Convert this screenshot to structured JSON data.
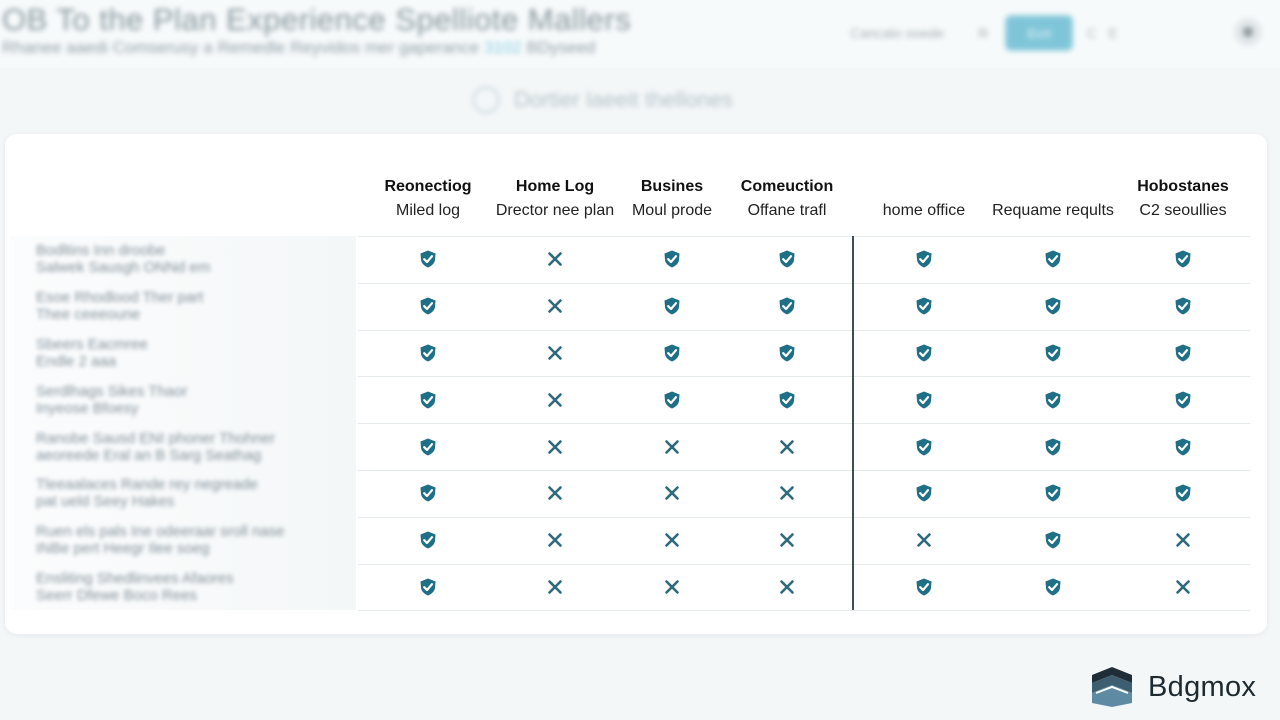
{
  "header": {
    "title": "OB To the Plan Experience Spelliote Mallers",
    "subtitle": "Rhanee aaedi Comserusy a Remedle Reyvidos mer gaperance",
    "subtitle_highlight": "3102",
    "subtitle_tail": "BDyseed",
    "actions": {
      "tab_text": "Cancalo ooede",
      "plain_button": "R",
      "primary_button": "Ecrt",
      "more": "C E"
    }
  },
  "section_heading": "Dortier laeeit thellones",
  "table": {
    "columns": [
      {
        "title": "Reonectiog",
        "subtitle": "Miled log"
      },
      {
        "title": "Home Log",
        "subtitle": "Drector nee plan"
      },
      {
        "title": "Busines",
        "subtitle": "Moul prode"
      },
      {
        "title": "Comeuction",
        "subtitle": "Offane trafl"
      },
      {
        "title": "",
        "subtitle": "home office"
      },
      {
        "title": "",
        "subtitle": "Requame reqults"
      },
      {
        "title": "Hobostanes",
        "subtitle": "C2 seoullies"
      }
    ],
    "rows": [
      {
        "label_1": "Bodltins Inn droobe",
        "label_2": "Salwek Sausgh ONNd em",
        "values": [
          "check",
          "cross",
          "check",
          "check",
          "check",
          "check",
          "check"
        ]
      },
      {
        "label_1": "Esoe Rhodlood Ther part",
        "label_2": "Thee ceeeoune",
        "values": [
          "check",
          "cross",
          "check",
          "check",
          "check",
          "check",
          "check"
        ]
      },
      {
        "label_1": "Sbeers Eacmree",
        "label_2": "Endle 2 aaa",
        "values": [
          "check",
          "cross",
          "check",
          "check",
          "check",
          "check",
          "check"
        ]
      },
      {
        "label_1": "Serdlhags Sikes Thaor",
        "label_2": "Inyeose Bfoesy",
        "values": [
          "check",
          "cross",
          "check",
          "check",
          "check",
          "check",
          "check"
        ]
      },
      {
        "label_1": "Ranobe Sausd ENI phoner Thohner",
        "label_2": "aeoreede Eral an B Sarg Seathag",
        "values": [
          "check",
          "cross",
          "cross",
          "cross",
          "check",
          "check",
          "check"
        ]
      },
      {
        "label_1": "Tleeaalaces Rande rey negreade",
        "label_2": "pat ueld Seey Hakes",
        "values": [
          "check",
          "cross",
          "cross",
          "cross",
          "check",
          "check",
          "check"
        ]
      },
      {
        "label_1": "Ruen els pals Ine odeeraar sroll nase",
        "label_2": "INBe pert Heegr Ilee soeg",
        "values": [
          "check",
          "cross",
          "cross",
          "cross",
          "cross",
          "check",
          "cross"
        ]
      },
      {
        "label_1": "Ensliting Shedlinvees Afaores",
        "label_2": "Seerr Dfewe Boco Rees",
        "values": [
          "check",
          "cross",
          "cross",
          "cross",
          "check",
          "check",
          "cross"
        ]
      }
    ]
  },
  "brand": {
    "name": "Bdgmox"
  },
  "colors": {
    "check": "#1f6f86",
    "cross": "#2e6a7c",
    "accent": "#1e9bbd"
  },
  "icons": {
    "check": "shield-check-icon",
    "cross": "x-mark-icon",
    "logo": "bdgmox-logo-icon"
  }
}
